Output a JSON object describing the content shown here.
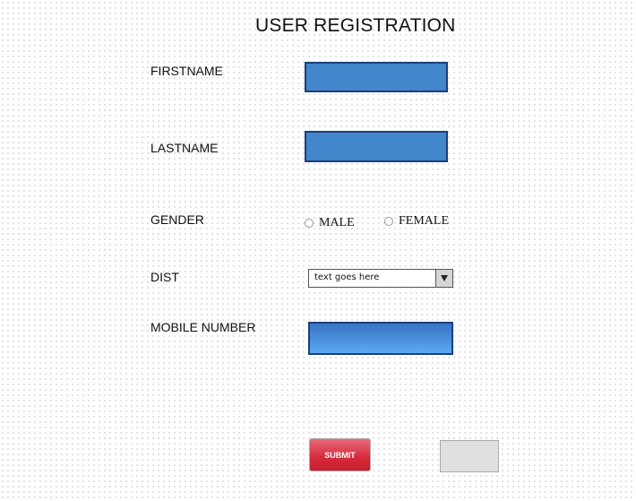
{
  "form": {
    "title": "USER REGISTRATION",
    "firstname_label": "FIRSTNAME",
    "lastname_label": "LASTNAME",
    "gender_label": "GENDER",
    "gender_options": [
      "MALE",
      "FEMALE"
    ],
    "dist_label": "DIST",
    "dist_selected": "text goes here",
    "mobile_label": "MOBILE NUMBER",
    "submit_label": "SUBMIT",
    "second_button_label": ""
  },
  "colors": {
    "input_fill": "#4286cc",
    "input_border": "#1d3f7a",
    "submit_fill": "#d42a3a",
    "secondary_button_fill": "#e0e0e0"
  }
}
